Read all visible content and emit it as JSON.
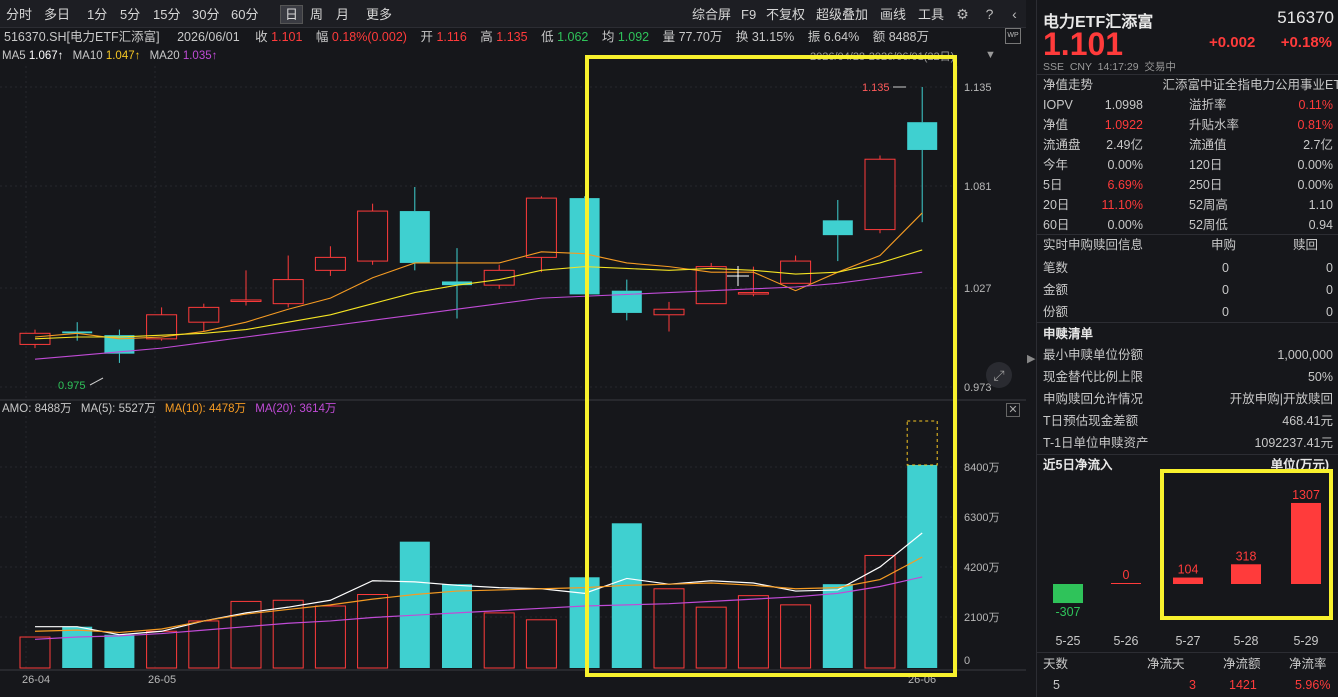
{
  "toolbar": {
    "left": [
      "分时",
      "多日",
      "1分",
      "5分",
      "15分",
      "30分",
      "60分",
      "日",
      "周",
      "月",
      "更多"
    ],
    "active": "日",
    "right": [
      "综合屏",
      "F9",
      "不复权",
      "超级叠加",
      "画线",
      "工具"
    ]
  },
  "info": {
    "code": "516370.SH[电力ETF汇添富]",
    "date": "2026/06/01",
    "close_label": "收",
    "close": "1.101",
    "range_label": "幅",
    "range": "0.18%(0.002)",
    "open_label": "开",
    "open": "1.116",
    "high_label": "高",
    "high": "1.135",
    "low_label": "低",
    "low": "1.062",
    "avg_label": "均",
    "avg": "1.092",
    "vol_label": "量",
    "vol": "77.70万",
    "turn_label": "换",
    "turn": "31.15%",
    "amp_label": "振",
    "amp": "6.64%",
    "amt_label": "额",
    "amt": "8488万",
    "period": "2026/04/28-2026/06/01(22日)"
  },
  "ma": {
    "ma5_label": "MA5",
    "ma5": "1.067↑",
    "ma10_label": "MA10",
    "ma10": "1.047↑",
    "ma20_label": "MA20",
    "ma20": "1.035↑"
  },
  "amo": {
    "label": "AMO: 8488万",
    "ma5": "MA(5): 5527万",
    "ma10": "MA(10): 4478万",
    "ma20": "MA(20): 3614万"
  },
  "axis": {
    "price_ticks": [
      "1.135",
      "1.081",
      "1.027",
      "0.973"
    ],
    "vol_ticks": [
      "8400万",
      "6300万",
      "4200万",
      "2100万",
      "0"
    ],
    "x_labels": [
      "26-04",
      "26-05",
      "26-06"
    ],
    "hi_label": "1.135",
    "lo_label": "0.975"
  },
  "colors": {
    "up": "#ff3b3b",
    "down": "#3fd0d0",
    "ma5": "#ffffff",
    "ma10": "#f59b23",
    "ma20": "#c04bd6",
    "highlight": "#f8f12d"
  },
  "chart_data": {
    "type": "candlestick",
    "candles": [
      {
        "o": 0.996,
        "c": 1.002,
        "h": 1.004,
        "l": 0.994
      },
      {
        "o": 1.003,
        "c": 1.002,
        "h": 1.008,
        "l": 0.998
      },
      {
        "o": 1.001,
        "c": 0.991,
        "h": 1.004,
        "l": 0.986
      },
      {
        "o": 0.999,
        "c": 1.012,
        "h": 1.016,
        "l": 0.998
      },
      {
        "o": 1.008,
        "c": 1.016,
        "h": 1.018,
        "l": 1.003
      },
      {
        "o": 1.02,
        "c": 1.02,
        "h": 1.036,
        "l": 1.017
      },
      {
        "o": 1.018,
        "c": 1.031,
        "h": 1.044,
        "l": 1.016
      },
      {
        "o": 1.036,
        "c": 1.043,
        "h": 1.049,
        "l": 1.033
      },
      {
        "o": 1.041,
        "c": 1.068,
        "h": 1.072,
        "l": 1.039
      },
      {
        "o": 1.068,
        "c": 1.04,
        "h": 1.081,
        "l": 1.036
      },
      {
        "o": 1.03,
        "c": 1.028,
        "h": 1.048,
        "l": 1.01
      },
      {
        "o": 1.028,
        "c": 1.036,
        "h": 1.039,
        "l": 1.026
      },
      {
        "o": 1.043,
        "c": 1.075,
        "h": 1.076,
        "l": 1.035
      },
      {
        "o": 1.075,
        "c": 1.023,
        "h": 1.076,
        "l": 1.023
      },
      {
        "o": 1.025,
        "c": 1.013,
        "h": 1.031,
        "l": 1.009
      },
      {
        "o": 1.012,
        "c": 1.015,
        "h": 1.019,
        "l": 1.003
      },
      {
        "o": 1.018,
        "c": 1.038,
        "h": 1.04,
        "l": 1.018
      },
      {
        "o": 1.024,
        "c": 1.024,
        "h": 1.038,
        "l": 1.022
      },
      {
        "o": 1.029,
        "c": 1.041,
        "h": 1.044,
        "l": 1.029
      },
      {
        "o": 1.063,
        "c": 1.055,
        "h": 1.074,
        "l": 1.041
      },
      {
        "o": 1.058,
        "c": 1.096,
        "h": 1.098,
        "l": 1.056
      },
      {
        "o": 1.116,
        "c": 1.101,
        "h": 1.135,
        "l": 1.062
      }
    ],
    "ma5_line": [
      1.0,
      1.002,
      0.999,
      1.0,
      1.003,
      1.008,
      1.015,
      1.021,
      1.032,
      1.04,
      1.04,
      1.04,
      1.046,
      1.045,
      1.04,
      1.038,
      1.035,
      1.035,
      1.025,
      1.035,
      1.044,
      1.067
    ],
    "ma10_line": [
      0.999,
      1.0,
      1.0,
      1.001,
      1.002,
      1.004,
      1.008,
      1.012,
      1.018,
      1.024,
      1.028,
      1.031,
      1.036,
      1.038,
      1.037,
      1.036,
      1.037,
      1.036,
      1.034,
      1.035,
      1.04,
      1.047
    ],
    "ma20_line": [
      0.988,
      0.99,
      0.992,
      0.994,
      0.997,
      1.0,
      1.003,
      1.006,
      1.009,
      1.012,
      1.015,
      1.018,
      1.021,
      1.022,
      1.023,
      1.024,
      1.025,
      1.026,
      1.027,
      1.029,
      1.032,
      1.035
    ],
    "volume": [
      1000,
      1450,
      1100,
      1250,
      1700,
      2550,
      2600,
      2350,
      2850,
      5150,
      3300,
      2050,
      1750,
      3600,
      5950,
      3100,
      2300,
      2800,
      2400,
      3300,
      4550,
      8488,
      8488
    ],
    "amo_ma5": [
      1450,
      1450,
      1100,
      1250,
      1700,
      2050,
      2300,
      2600,
      3450,
      3400,
      3250,
      3150,
      3100,
      2900,
      3550,
      3300,
      3450,
      3350,
      3000,
      3050,
      4050,
      5527
    ],
    "amo_ma10": [
      1250,
      1300,
      1200,
      1350,
      1700,
      2000,
      2200,
      2400,
      2650,
      2850,
      3000,
      3050,
      3100,
      3150,
      3250,
      3300,
      3350,
      3250,
      3100,
      3150,
      3500,
      4478
    ],
    "amo_ma20": [
      900,
      1000,
      1050,
      1150,
      1300,
      1450,
      1600,
      1700,
      1850,
      1950,
      2050,
      2150,
      2250,
      2350,
      2400,
      2450,
      2550,
      2650,
      2750,
      2900,
      3200,
      3614
    ]
  },
  "quote": {
    "name": "电力ETF汇添富",
    "code": "516370",
    "price": "1.101",
    "change": "+0.002",
    "pct": "+0.18%",
    "meta": "SSE  CNY  14:17:29  交易中",
    "nav_label": "净值走势",
    "nav_name": "汇添富中证全指电力公用事业ET"
  },
  "stats": [
    [
      "IOPV",
      "1.0998",
      "溢折率",
      "0.11%"
    ],
    [
      "净值",
      "1.0922",
      "升贴水率",
      "0.81%"
    ],
    [
      "流通盘",
      "2.49亿",
      "流通值",
      "2.7亿"
    ],
    [
      "今年",
      "0.00%",
      "120日",
      "0.00%"
    ],
    [
      "5日",
      "6.69%",
      "250日",
      "0.00%"
    ],
    [
      "20日",
      "11.10%",
      "52周高",
      "1.10"
    ],
    [
      "60日",
      "0.00%",
      "52周低",
      "0.94"
    ]
  ],
  "sub": {
    "header": [
      "实时申购赎回信息",
      "申购",
      "赎回"
    ],
    "rows": [
      [
        "笔数",
        "0",
        "0"
      ],
      [
        "金额",
        "0",
        "0"
      ],
      [
        "份额",
        "0",
        "0"
      ]
    ]
  },
  "list": {
    "title": "申赎清单",
    "rows": [
      [
        "最小申赎单位份额",
        "1,000,000"
      ],
      [
        "现金替代比例上限",
        "50%"
      ],
      [
        "申购赎回允许情况",
        "开放申购|开放赎回"
      ],
      [
        "T日预估现金差额",
        "468.41元"
      ],
      [
        "T-1日单位申赎资产",
        "1092237.41元"
      ]
    ]
  },
  "flow": {
    "title": "近5日净流入",
    "unit": "单位(万元)",
    "bars": [
      {
        "date": "5-25",
        "value": -307
      },
      {
        "date": "5-26",
        "value": 0
      },
      {
        "date": "5-27",
        "value": 104
      },
      {
        "date": "5-28",
        "value": 318
      },
      {
        "date": "5-29",
        "value": 1307
      }
    ],
    "table_header": [
      "天数",
      "净流天",
      "净流额",
      "净流率"
    ],
    "table_row": [
      "5",
      "3",
      "1421",
      "5.96%"
    ]
  }
}
